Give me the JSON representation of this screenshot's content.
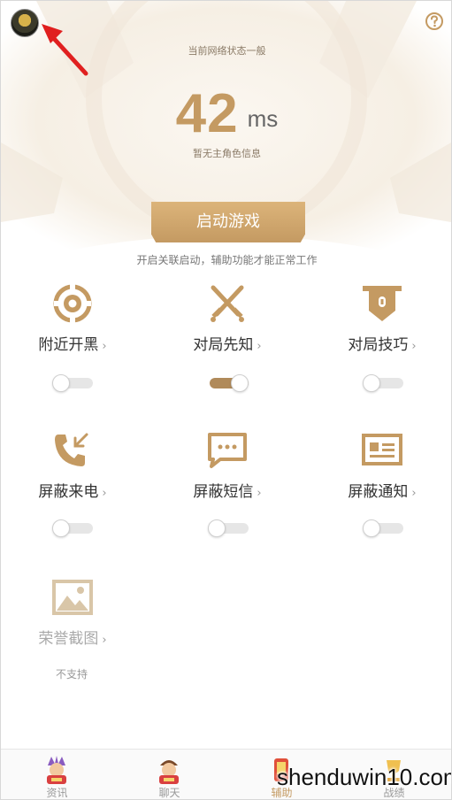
{
  "header": {
    "network_status": "当前网络状态一般",
    "ping_value": "42",
    "ping_unit": "ms",
    "role_info": "暂无主角色信息"
  },
  "start": {
    "button_label": "启动游戏",
    "hint": "开启关联启动，辅助功能才能正常工作"
  },
  "features": [
    {
      "label": "附近开黑",
      "icon": "target-icon",
      "toggle_on": false
    },
    {
      "label": "对局先知",
      "icon": "crossed-swords-icon",
      "toggle_on": true
    },
    {
      "label": "对局技巧",
      "icon": "banner-shield-icon",
      "toggle_on": false
    },
    {
      "label": "屏蔽来电",
      "icon": "phone-incoming-icon",
      "toggle_on": false
    },
    {
      "label": "屏蔽短信",
      "icon": "message-icon",
      "toggle_on": false
    },
    {
      "label": "屏蔽通知",
      "icon": "notification-card-icon",
      "toggle_on": false
    },
    {
      "label": "荣誉截图",
      "icon": "image-icon",
      "toggle_on": null,
      "status": "不支持"
    }
  ],
  "chevron": "›",
  "tabs": [
    {
      "label": "资讯",
      "active": false
    },
    {
      "label": "聊天",
      "active": false
    },
    {
      "label": "辅助",
      "active": true
    },
    {
      "label": "战绩",
      "active": false
    }
  ],
  "watermark": "shenduwin10.com",
  "colors": {
    "accent": "#c49a62",
    "accent_dark": "#b08a5a",
    "text": "#333333",
    "muted": "#999999"
  }
}
